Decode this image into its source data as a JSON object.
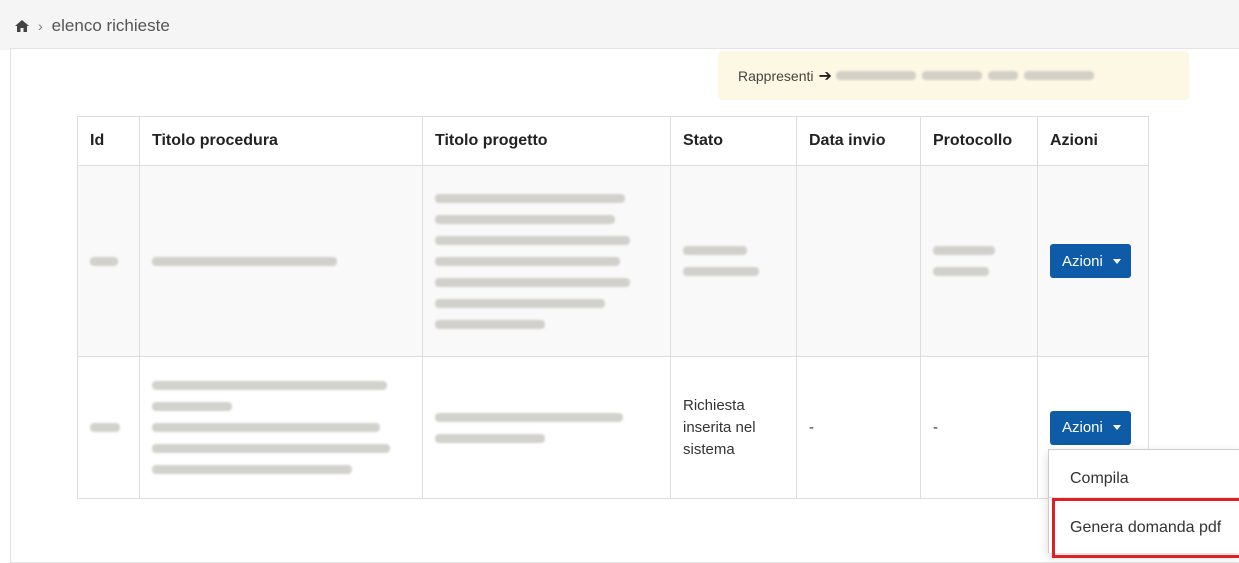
{
  "breadcrumb": {
    "home_icon": "home-icon",
    "separator": "›",
    "current": "elenco richieste"
  },
  "representation": {
    "label": "Rappresenti",
    "arrow": "➔"
  },
  "table": {
    "columns": [
      "Id",
      "Titolo procedura",
      "Titolo progetto",
      "Stato",
      "Data invio",
      "Protocollo",
      "Azioni"
    ],
    "rows": [
      {
        "stato": "",
        "data_invio": "",
        "protocollo": "",
        "action_label": "Azioni"
      },
      {
        "stato": "Richiesta inserita nel sistema",
        "data_invio": "-",
        "protocollo": "-",
        "action_label": "Azioni"
      }
    ]
  },
  "dropdown": {
    "items": [
      "Compila",
      "Genera domanda pdf"
    ]
  },
  "colors": {
    "primary_button": "#0e5ba8",
    "highlight": "#e01e26",
    "warning_bg": "#fcf8e3"
  }
}
